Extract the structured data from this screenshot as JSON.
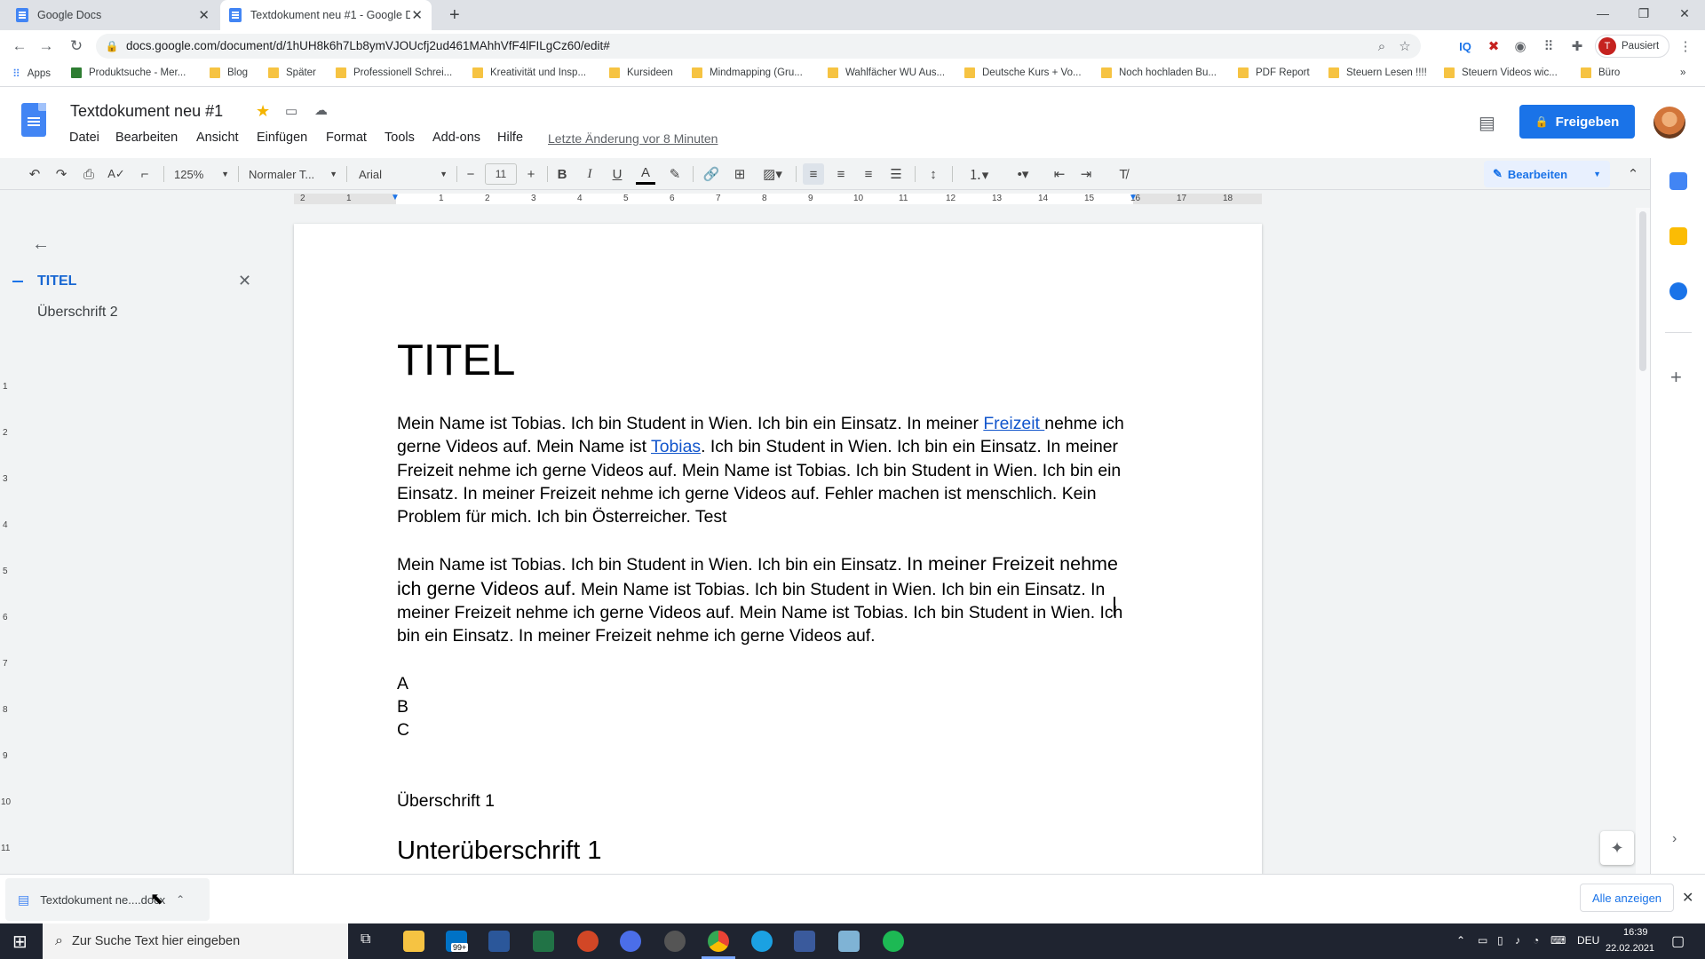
{
  "browser": {
    "tabs": [
      {
        "title": "Google Docs"
      },
      {
        "title": "Textdokument neu #1 - Google D"
      }
    ],
    "url": "docs.google.com/document/d/1hUH8k6h7Lb8ymVJOUcfj2ud461MAhhVfF4lFILgCz60/edit#",
    "profile_label": "Pausiert",
    "profile_initial": "T",
    "bookmarks": [
      "Apps",
      "Produktsuche - Mer...",
      "Blog",
      "Später",
      "Professionell Schrei...",
      "Kreativität und Insp...",
      "Kursideen",
      "Mindmapping (Gru...",
      "Wahlfächer WU Aus...",
      "Deutsche Kurs + Vo...",
      "Noch hochladen Bu...",
      "PDF Report",
      "Steuern Lesen !!!!",
      "Steuern Videos wic...",
      "Büro"
    ]
  },
  "doc": {
    "title": "Textdokument neu #1",
    "menu": [
      "Datei",
      "Bearbeiten",
      "Ansicht",
      "Einfügen",
      "Format",
      "Tools",
      "Add-ons",
      "Hilfe"
    ],
    "last_edit": "Letzte Änderung vor 8 Minuten",
    "share_label": "Freigeben"
  },
  "toolbar": {
    "zoom": "125%",
    "style": "Normaler T...",
    "font": "Arial",
    "font_size": "11",
    "mode": "Bearbeiten"
  },
  "ruler": [
    "2",
    "1",
    "1",
    "2",
    "3",
    "4",
    "5",
    "6",
    "7",
    "8",
    "9",
    "10",
    "11",
    "12",
    "13",
    "14",
    "15",
    "16",
    "17",
    "18"
  ],
  "vruler": [
    "1",
    "2",
    "3",
    "4",
    "5",
    "6",
    "7",
    "8",
    "9",
    "10",
    "11"
  ],
  "outline": {
    "items": [
      {
        "label": "TITEL"
      },
      {
        "label": "Überschrift 2"
      }
    ]
  },
  "content": {
    "title": "TITEL",
    "p1": {
      "a": "Mein Name ist Tobias. Ich bin Student in Wien. Ich bin ein Einsatz. In meiner ",
      "link1": "Freizeit ",
      "b": "nehme ich gerne Videos auf. Mein Name ist ",
      "link2": "Tobias",
      "c": ". Ich bin Student in Wien. Ich bin ein Einsatz. In meiner Freizeit nehme ich gerne Videos auf. Mein Name ist Tobias. Ich bin Student in Wien. Ich bin ein Einsatz. In meiner Freizeit nehme ich gerne Videos auf. Fehler machen ist menschlich. Kein Problem für mich. Ich bin Österreicher. Test"
    },
    "p2": {
      "a": "Mein Name ist Tobias. Ich bin Student in Wien. Ich bin ein Einsatz. ",
      "big": "In meiner Freizeit nehme ich gerne Videos auf.",
      "b": " Mein Name ist Tobias. Ich bin Student in Wien. Ich bin ein Einsatz. In meiner Freizeit nehme ich gerne Videos auf. Mein Name ist Tobias. Ich bin Student in Wien. Ich bin ein Einsatz. In meiner Freizeit nehme ich gerne Videos auf."
    },
    "list": [
      "A",
      "B",
      "C"
    ],
    "heading1": "Überschrift 1",
    "heading2": "Unterüberschrift 1"
  },
  "download": {
    "file": "Textdokument ne....docx",
    "show_all": "Alle anzeigen"
  },
  "taskbar": {
    "search_placeholder": "Zur Suche Text hier eingeben",
    "mail_badge": "99+",
    "lang": "DEU",
    "time": "16:39",
    "date": "22.02.2021"
  }
}
